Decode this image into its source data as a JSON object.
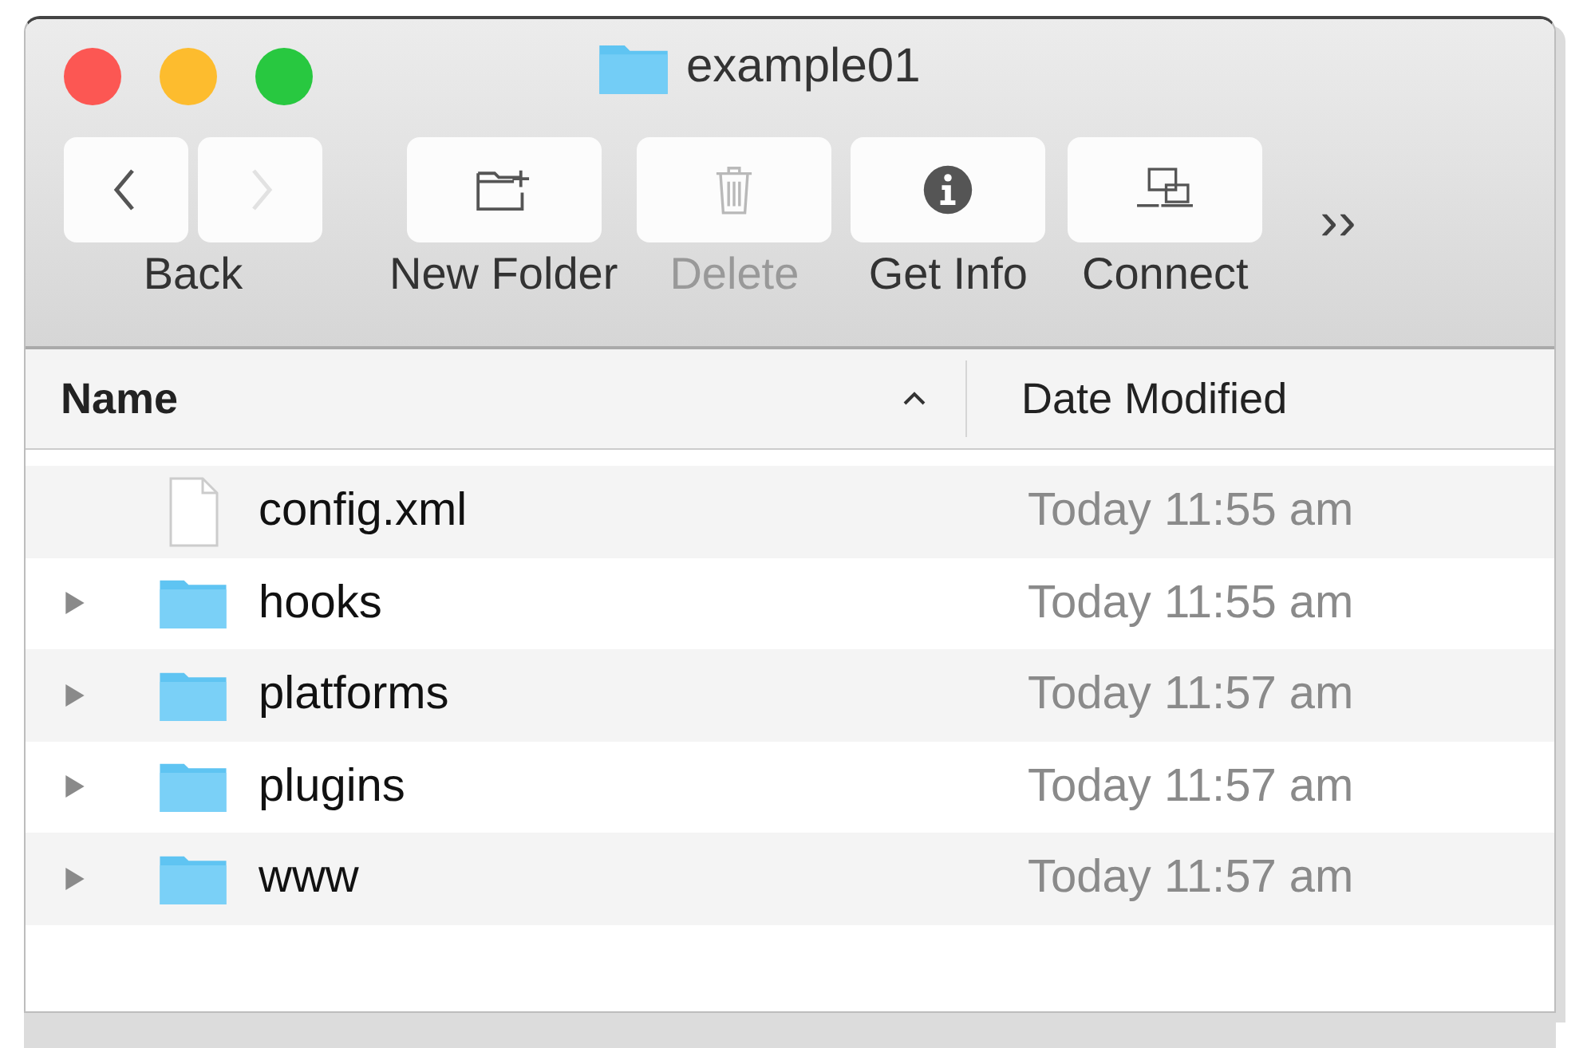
{
  "window": {
    "title": "example01"
  },
  "toolbar": {
    "items": [
      {
        "kind": "nav",
        "label": "Back",
        "disabled": false
      },
      {
        "kind": "new-folder",
        "label": "New Folder",
        "disabled": false
      },
      {
        "kind": "delete",
        "label": "Delete",
        "disabled": true
      },
      {
        "kind": "info",
        "label": "Get Info",
        "disabled": false
      },
      {
        "kind": "connect",
        "label": "Connect",
        "disabled": false
      }
    ],
    "overflow": "››"
  },
  "table": {
    "columns": [
      {
        "label": "Name",
        "sorted": true
      },
      {
        "label": "Date Modified",
        "sorted": false
      }
    ],
    "rows": [
      {
        "kind": "file",
        "name": "config.xml",
        "date": "Today 11:55 am"
      },
      {
        "kind": "folder",
        "name": "hooks",
        "date": "Today 11:55 am"
      },
      {
        "kind": "folder",
        "name": "platforms",
        "date": "Today 11:57 am"
      },
      {
        "kind": "folder",
        "name": "plugins",
        "date": "Today 11:57 am"
      },
      {
        "kind": "folder",
        "name": "www",
        "date": "Today 11:57 am"
      }
    ]
  }
}
